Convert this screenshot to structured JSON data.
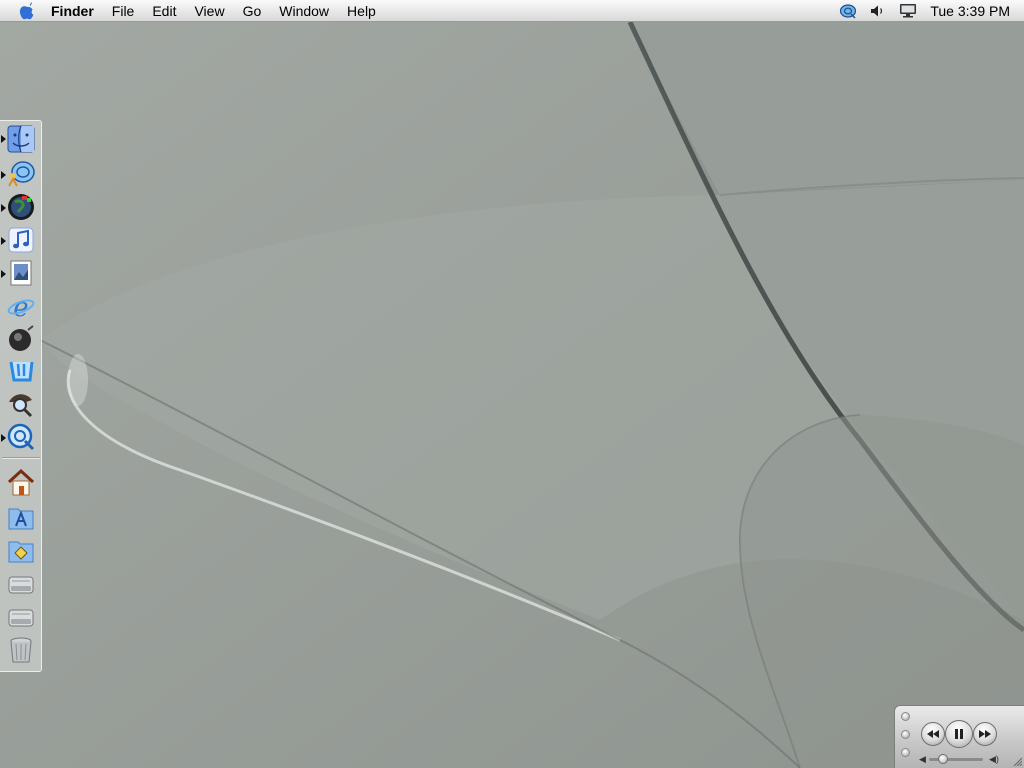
{
  "menubar": {
    "app_name": "Finder",
    "items": [
      "File",
      "Edit",
      "View",
      "Go",
      "Window",
      "Help"
    ],
    "clock": "Tue 3:39 PM",
    "status_icons": [
      "ichat-status-icon",
      "volume-icon",
      "display-icon"
    ]
  },
  "dock": {
    "items": [
      {
        "icon": "finder-icon",
        "running": true
      },
      {
        "icon": "ichat-icon",
        "running": true
      },
      {
        "icon": "globe-app-icon",
        "running": true
      },
      {
        "icon": "itunes-icon",
        "running": true
      },
      {
        "icon": "preview-icon",
        "running": true
      },
      {
        "icon": "internet-explorer-icon",
        "running": false
      },
      {
        "icon": "speaker-app-icon",
        "running": false
      },
      {
        "icon": "ilife-app-icon",
        "running": false
      },
      {
        "icon": "sherlock-icon",
        "running": false
      },
      {
        "icon": "quicktime-icon",
        "running": true
      },
      {
        "icon": "home-folder-icon",
        "running": false
      },
      {
        "icon": "applications-folder-icon",
        "running": false
      },
      {
        "icon": "documents-folder-icon",
        "running": false
      },
      {
        "icon": "hard-drive-icon",
        "running": false
      },
      {
        "icon": "hard-drive-icon",
        "running": false
      },
      {
        "icon": "trash-icon",
        "running": false
      }
    ]
  },
  "mini_player": {
    "controls": [
      "rewind-icon",
      "pause-icon",
      "fast-forward-icon"
    ],
    "volume_level": 0.25
  },
  "colors": {
    "wallpaper_base": "#8e948f",
    "menubar": "#e6e6e6",
    "accent_blue": "#2f6fd6"
  }
}
